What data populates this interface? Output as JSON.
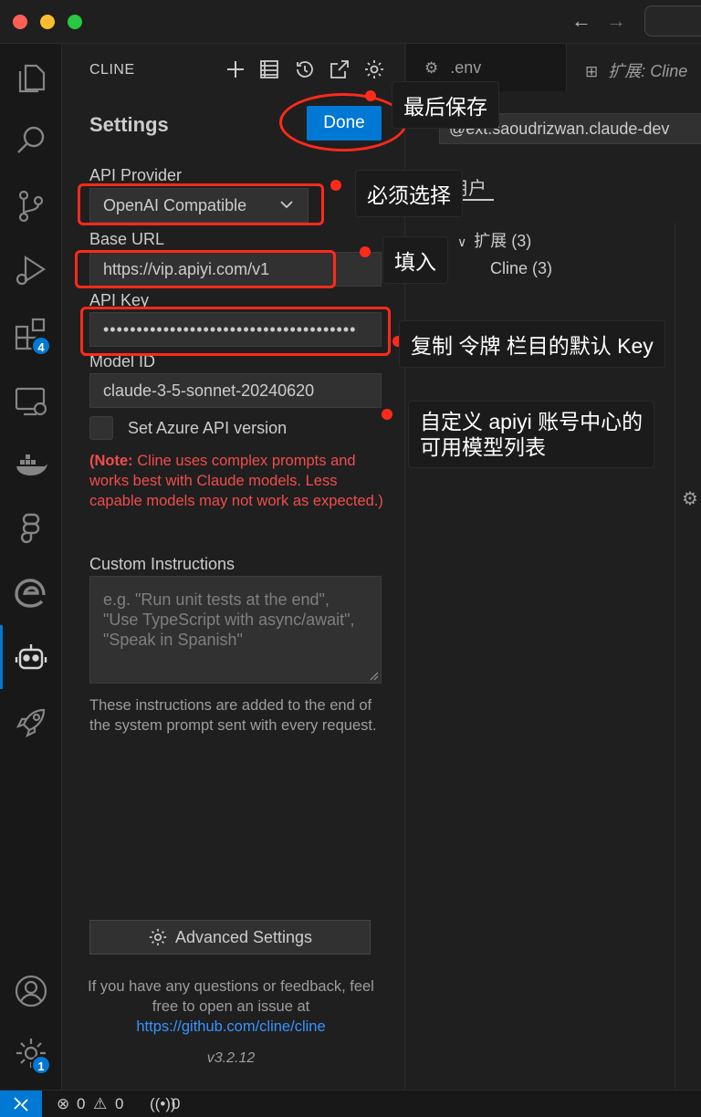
{
  "titlebar": {
    "back": "←",
    "forward": "→"
  },
  "activity": {
    "extensions_badge": "4",
    "manage_badge": "1"
  },
  "panel": {
    "title": "CLINE",
    "heading": "Settings",
    "done_label": "Done",
    "api_provider": {
      "label": "API Provider",
      "value": "OpenAI Compatible"
    },
    "base_url": {
      "label": "Base URL",
      "value": "https://vip.apiyi.com/v1"
    },
    "api_key": {
      "label": "API Key",
      "value": "••••••••••••••••••••••••••••••••••••••"
    },
    "model_id": {
      "label": "Model ID",
      "value": "claude-3-5-sonnet-20240620"
    },
    "azure_checkbox": {
      "label": "Set Azure API version",
      "checked": false
    },
    "note": {
      "prefix": "(Note:",
      "text": " Cline uses complex prompts and works best with Claude models. Less capable models may not work as expected.)"
    },
    "custom_instructions": {
      "label": "Custom Instructions",
      "placeholder": "e.g. \"Run unit tests at the end\", \"Use TypeScript with async/await\", \"Speak in Spanish\""
    },
    "helper": "These instructions are added to the end of the system prompt sent with every request.",
    "advanced_label": "Advanced Settings",
    "footer": {
      "text": "If you have any questions or feedback, feel free to open an issue at ",
      "link": "https://github.com/cline/cline"
    },
    "version": "v3.2.12"
  },
  "editor": {
    "tab_env": ".env",
    "tab_ext": "扩展: Cline",
    "search_value": "@ext:saoudrizwan.claude-dev",
    "section": "用户",
    "tree_group": "扩展 (3)",
    "tree_child": "Cline (3)"
  },
  "annotations": {
    "save": "最后保存",
    "select": "必须选择",
    "fill": "填入",
    "copy": "复制 令牌 栏目的默认 Key",
    "custom_line1": "自定义 apiyi 账号中心的",
    "custom_line2": "可用模型列表"
  },
  "status": {
    "errors": "0",
    "warnings": "0",
    "ports": "0"
  },
  "colors": {
    "accent": "#0078d4",
    "annotation_red": "#ff2a1a",
    "note_red": "#f14c4c",
    "link": "#3794ff"
  }
}
